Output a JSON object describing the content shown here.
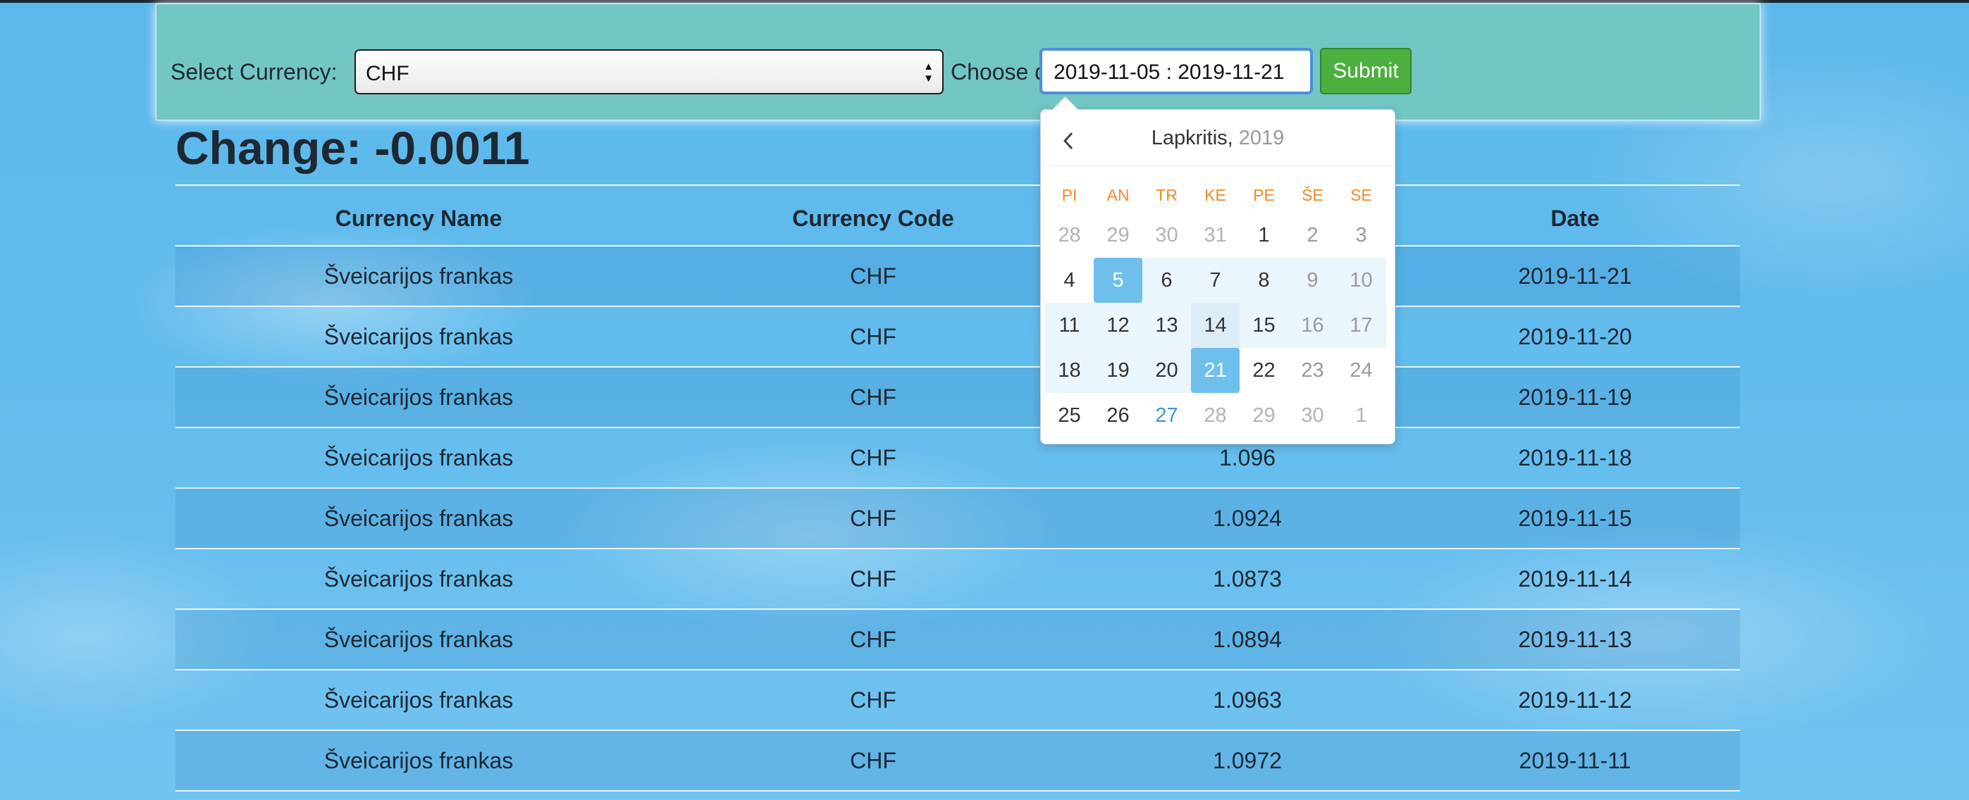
{
  "header": {
    "select_label": "Select Currency:",
    "select_value": "CHF",
    "date_label": "Choose date: From - To",
    "date_value": "2019-11-05 : 2019-11-21",
    "submit_label": "Submit"
  },
  "change_text": "Change: -0.0011",
  "table": {
    "headers": [
      "Currency Name",
      "Currency Code",
      "Date"
    ],
    "rows": [
      {
        "name": "Šveicarijos frankas",
        "code": "CHF",
        "rate": "",
        "date": "2019-11-21"
      },
      {
        "name": "Šveicarijos frankas",
        "code": "CHF",
        "rate": "",
        "date": "2019-11-20"
      },
      {
        "name": "Šveicarijos frankas",
        "code": "CHF",
        "rate": "",
        "date": "2019-11-19"
      },
      {
        "name": "Šveicarijos frankas",
        "code": "CHF",
        "rate": "1.096",
        "date": "2019-11-18"
      },
      {
        "name": "Šveicarijos frankas",
        "code": "CHF",
        "rate": "1.0924",
        "date": "2019-11-15"
      },
      {
        "name": "Šveicarijos frankas",
        "code": "CHF",
        "rate": "1.0873",
        "date": "2019-11-14"
      },
      {
        "name": "Šveicarijos frankas",
        "code": "CHF",
        "rate": "1.0894",
        "date": "2019-11-13"
      },
      {
        "name": "Šveicarijos frankas",
        "code": "CHF",
        "rate": "1.0963",
        "date": "2019-11-12"
      },
      {
        "name": "Šveicarijos frankas",
        "code": "CHF",
        "rate": "1.0972",
        "date": "2019-11-11"
      }
    ]
  },
  "calendar": {
    "month": "Lapkritis,",
    "year": "2019",
    "weekdays": [
      "PI",
      "AN",
      "TR",
      "KE",
      "PE",
      "ŠE",
      "SE"
    ],
    "weeks": [
      [
        "28",
        "29",
        "30",
        "31",
        "1",
        "2",
        "3"
      ],
      [
        "4",
        "5",
        "6",
        "7",
        "8",
        "9",
        "10"
      ],
      [
        "11",
        "12",
        "13",
        "14",
        "15",
        "16",
        "17"
      ],
      [
        "18",
        "19",
        "20",
        "21",
        "22",
        "23",
        "24"
      ],
      [
        "25",
        "26",
        "27",
        "28",
        "29",
        "30",
        "1"
      ]
    ],
    "range_start": "5",
    "range_end": "21",
    "today": "27"
  },
  "colors": {
    "panel": "#72c6c4",
    "submit": "#4caf3f",
    "selected_day": "#6ebfec",
    "weekday_header": "#f08a24"
  },
  "icons": {
    "prev_month": "chevron-left-icon",
    "select_arrows": "up-down-arrows-icon"
  }
}
